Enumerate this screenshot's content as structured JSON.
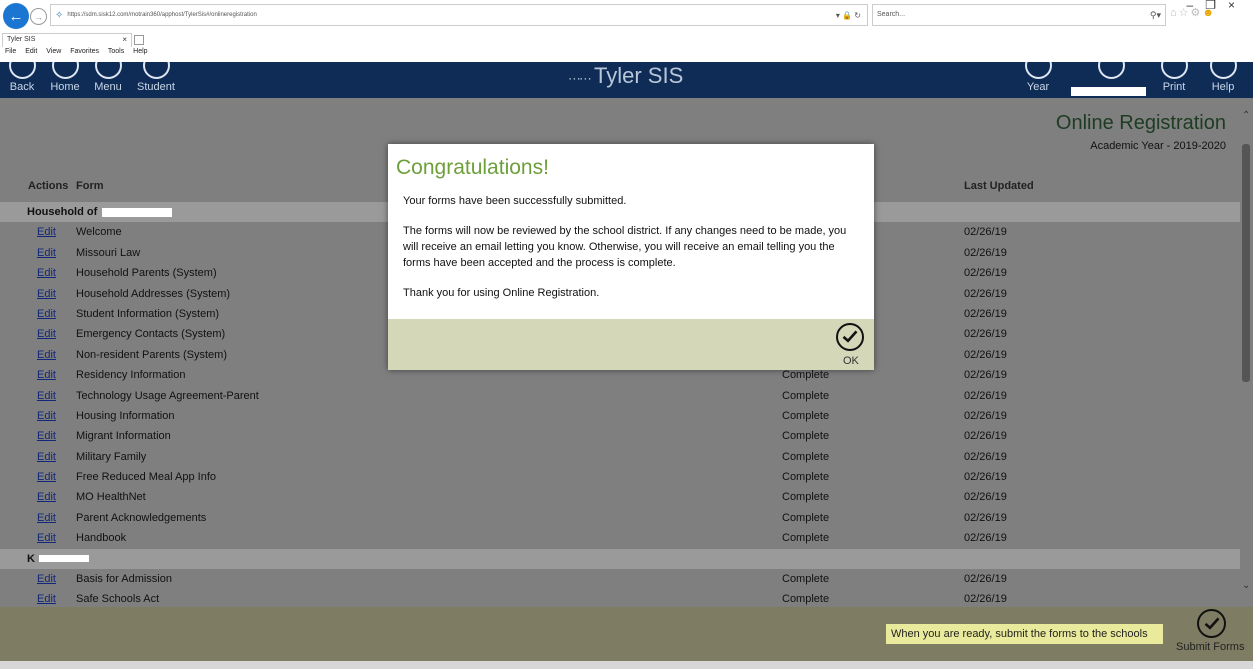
{
  "browser": {
    "url": "https://sdm.sisk12.com/motrain360/apphost/TylerSis#/onlineregistration",
    "search_placeholder": "Search...",
    "tab_title": "Tyler SIS",
    "menu": [
      "File",
      "Edit",
      "View",
      "Favorites",
      "Tools",
      "Help"
    ]
  },
  "header": {
    "brand": "Tyler SIS",
    "buttons_left": [
      "Back",
      "Home",
      "Menu",
      "Student"
    ],
    "year_label": "Year",
    "print_label": "Print",
    "help_label": "Help"
  },
  "page": {
    "title": "Online Registration",
    "academic_year": "Academic Year - 2019-2020",
    "columns": {
      "actions": "Actions",
      "form": "Form",
      "last_updated": "Last Updated"
    },
    "edit_label": "Edit",
    "groups": [
      {
        "label": "Household of",
        "rows": [
          {
            "form": "Welcome",
            "status": "",
            "date": "02/26/19"
          },
          {
            "form": "Missouri Law",
            "status": "",
            "date": "02/26/19"
          },
          {
            "form": "Household Parents (System)",
            "status": "",
            "date": "02/26/19"
          },
          {
            "form": "Household Addresses (System)",
            "status": "",
            "date": "02/26/19"
          },
          {
            "form": "Student Information (System)",
            "status": "",
            "date": "02/26/19"
          },
          {
            "form": "Emergency Contacts (System)",
            "status": "",
            "date": "02/26/19"
          },
          {
            "form": "Non-resident Parents (System)",
            "status": "",
            "date": "02/26/19"
          },
          {
            "form": "Residency Information",
            "status": "Complete",
            "date": "02/26/19"
          },
          {
            "form": "Technology Usage Agreement-Parent",
            "status": "Complete",
            "date": "02/26/19"
          },
          {
            "form": "Housing Information",
            "status": "Complete",
            "date": "02/26/19"
          },
          {
            "form": "Migrant Information",
            "status": "Complete",
            "date": "02/26/19"
          },
          {
            "form": "Military Family",
            "status": "Complete",
            "date": "02/26/19"
          },
          {
            "form": "Free Reduced Meal App Info",
            "status": "Complete",
            "date": "02/26/19"
          },
          {
            "form": "MO HealthNet",
            "status": "Complete",
            "date": "02/26/19"
          },
          {
            "form": "Parent Acknowledgements",
            "status": "Complete",
            "date": "02/26/19"
          },
          {
            "form": "Handbook",
            "status": "Complete",
            "date": "02/26/19"
          }
        ]
      },
      {
        "label": "K",
        "rows": [
          {
            "form": "Basis for Admission",
            "status": "Complete",
            "date": "02/26/19"
          },
          {
            "form": "Safe Schools Act",
            "status": "Complete",
            "date": "02/26/19"
          }
        ]
      }
    ]
  },
  "footer": {
    "message": "When you are ready, submit the forms to the schools",
    "submit_label": "Submit Forms"
  },
  "modal": {
    "title": "Congratulations!",
    "paragraphs": [
      "Your forms have been successfully submitted.",
      "The forms will now be reviewed by the school district. If any changes need to be made, you will receive an email letting you know. Otherwise, you will receive an email telling you the forms have been accepted and the process is complete.",
      "Thank you for using Online Registration."
    ],
    "ok_label": "OK"
  },
  "colors": {
    "header_bg": "#0f2c57",
    "overlay_gray": "#7f7f7f",
    "modal_title_green": "#6d9f3b",
    "modal_footer": "#d5d7b9",
    "footer_bg": "#7e7d63",
    "footer_msg_bg": "#e9ea9b",
    "link_blue": "#11287a"
  }
}
